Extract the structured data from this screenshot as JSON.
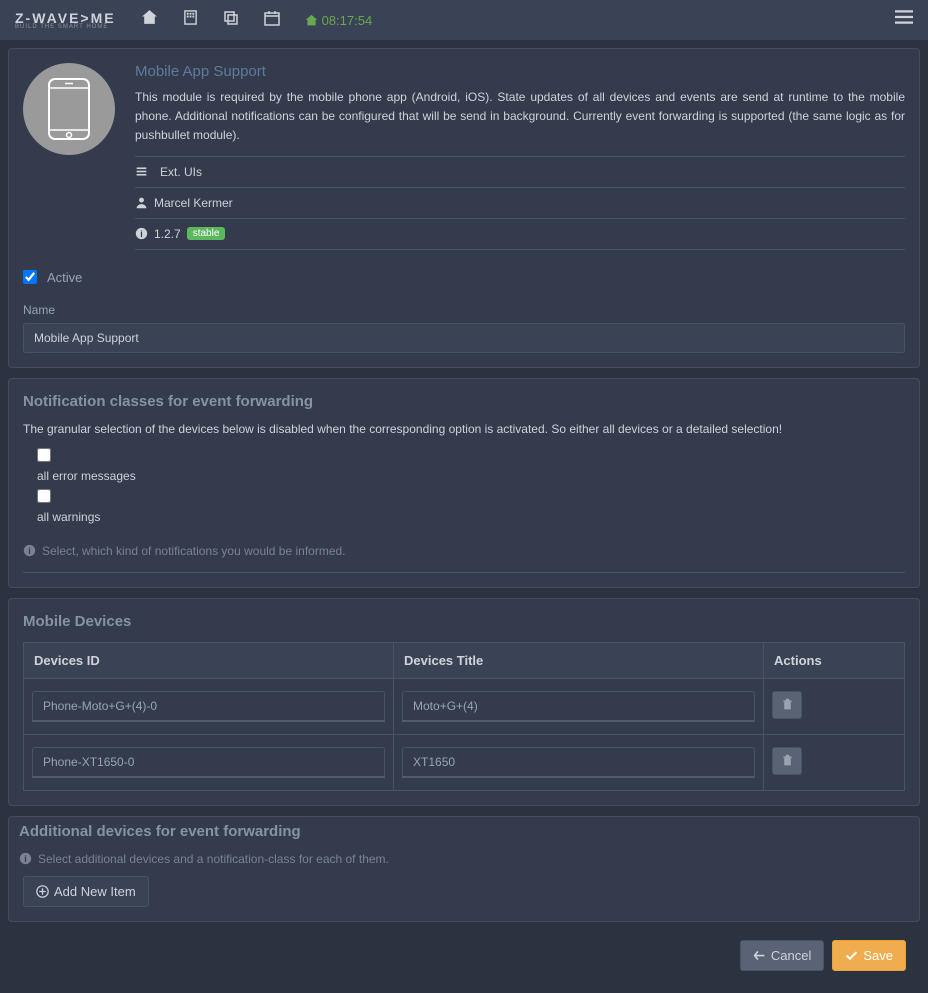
{
  "nav": {
    "logo_main": "Z-WAVE>ME",
    "logo_sub": "BUILD THE SMART HOME",
    "time": "08:17:54"
  },
  "module": {
    "title": "Mobile App Support",
    "desc": "This module is required by the mobile phone app (Android, iOS). State updates of all devices and events are send at runtime to the mobile phone. Additional notifications can be configured that will be send in background. Currently event forwarding is supported (the same logic as for pushbullet module).",
    "category": "Ext. UIs",
    "author": "Marcel Kermer",
    "version": "1.2.7",
    "stable": "stable",
    "active_label": "Active",
    "name_label": "Name",
    "name_value": "Mobile App Support"
  },
  "notif": {
    "title": "Notification classes for event forwarding",
    "desc": "The granular selection of the devices below is disabled when the corresponding option is activated. So either all devices or a detailed selection!",
    "opt_errors": "all error messages",
    "opt_warnings": "all warnings",
    "hint": "Select, which kind of notifications you would be informed."
  },
  "devices": {
    "title": "Mobile Devices",
    "col_id": "Devices ID",
    "col_title": "Devices Title",
    "col_actions": "Actions",
    "rows": [
      {
        "id": "Phone-Moto+G+(4)-0",
        "title": "Moto+G+(4)"
      },
      {
        "id": "Phone-XT1650-0",
        "title": "XT1650"
      }
    ]
  },
  "additional": {
    "title": "Additional devices for event forwarding",
    "hint": "Select additional devices and a notification-class for each of them.",
    "add_btn": "Add New Item"
  },
  "footer": {
    "cancel": "Cancel",
    "save": "Save"
  }
}
